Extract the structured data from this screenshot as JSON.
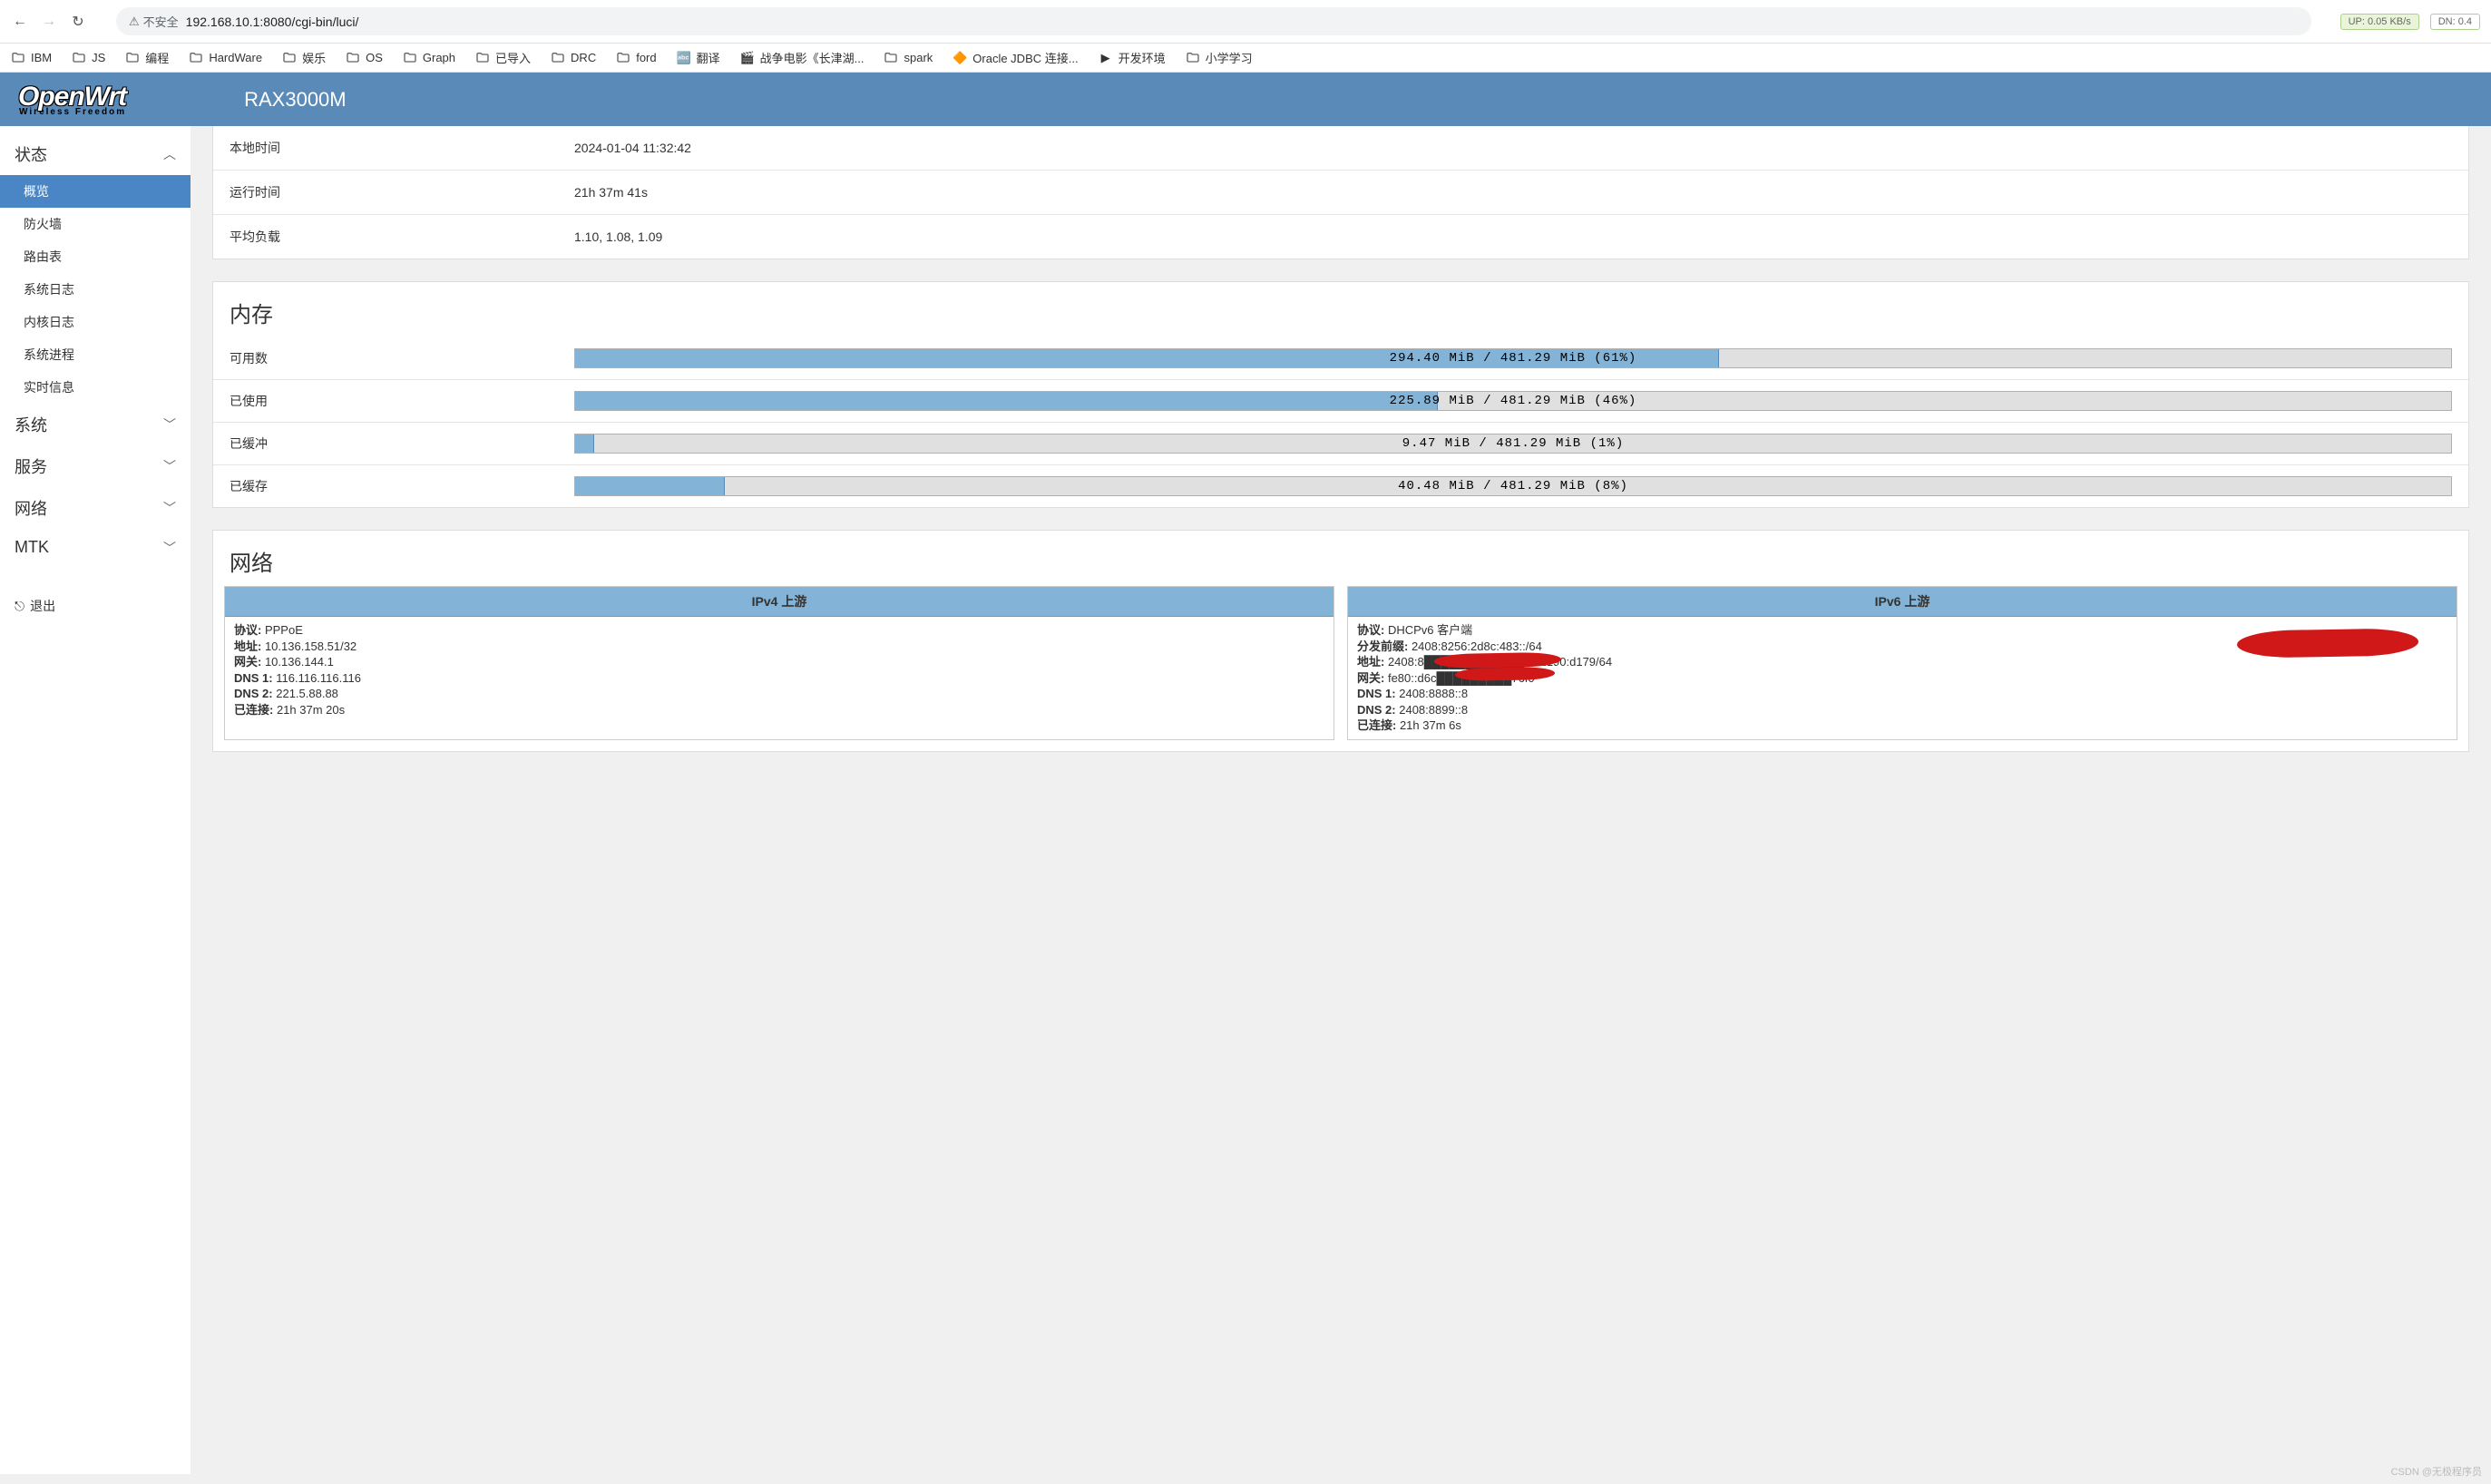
{
  "browser": {
    "security_label": "不安全",
    "url": "192.168.10.1:8080/cgi-bin/luci/",
    "up_label": "UP: 0.05 KB/s",
    "dn_label": "DN: 0.4"
  },
  "bookmarks": [
    {
      "label": "IBM",
      "type": "folder"
    },
    {
      "label": "JS",
      "type": "folder"
    },
    {
      "label": "编程",
      "type": "folder"
    },
    {
      "label": "HardWare",
      "type": "folder"
    },
    {
      "label": "娱乐",
      "type": "folder"
    },
    {
      "label": "OS",
      "type": "folder"
    },
    {
      "label": "Graph",
      "type": "folder"
    },
    {
      "label": "已导入",
      "type": "folder"
    },
    {
      "label": "DRC",
      "type": "folder"
    },
    {
      "label": "ford",
      "type": "folder"
    },
    {
      "label": "翻译",
      "type": "app",
      "icon": "🔤"
    },
    {
      "label": "战争电影《长津湖...",
      "type": "app",
      "icon": "🎬"
    },
    {
      "label": "spark",
      "type": "folder"
    },
    {
      "label": "Oracle JDBC 连接...",
      "type": "app",
      "icon": "🔶"
    },
    {
      "label": "开发环境",
      "type": "app",
      "icon": "▶"
    },
    {
      "label": "小学学习",
      "type": "folder"
    }
  ],
  "header": {
    "logo_main": "OpenWrt",
    "logo_sub": "Wireless Freedom",
    "model": "RAX3000M"
  },
  "sidebar": {
    "sections": [
      {
        "label": "状态",
        "expanded": true,
        "items": [
          {
            "label": "概览",
            "active": true
          },
          {
            "label": "防火墙"
          },
          {
            "label": "路由表"
          },
          {
            "label": "系统日志"
          },
          {
            "label": "内核日志"
          },
          {
            "label": "系统进程"
          },
          {
            "label": "实时信息"
          }
        ]
      },
      {
        "label": "系统",
        "expanded": false
      },
      {
        "label": "服务",
        "expanded": false
      },
      {
        "label": "网络",
        "expanded": false
      },
      {
        "label": "MTK",
        "expanded": false
      }
    ],
    "logout": "退出"
  },
  "system_info": {
    "rows": [
      {
        "label": "本地时间",
        "value": "2024-01-04 11:32:42"
      },
      {
        "label": "运行时间",
        "value": "21h 37m 41s"
      },
      {
        "label": "平均负载",
        "value": "1.10, 1.08, 1.09"
      }
    ]
  },
  "memory": {
    "title": "内存",
    "rows": [
      {
        "label": "可用数",
        "text": "294.40 MiB / 481.29 MiB (61%)",
        "pct": 61
      },
      {
        "label": "已使用",
        "text": "225.89 MiB / 481.29 MiB (46%)",
        "pct": 46
      },
      {
        "label": "已缓冲",
        "text": "9.47 MiB / 481.29 MiB (1%)",
        "pct": 1
      },
      {
        "label": "已缓存",
        "text": "40.48 MiB / 481.29 MiB (8%)",
        "pct": 8
      }
    ]
  },
  "network": {
    "title": "网络",
    "ipv4": {
      "title": "IPv4 上游",
      "lines": [
        {
          "k": "协议:",
          "v": " PPPoE"
        },
        {
          "k": "地址:",
          "v": " 10.136.158.51/32"
        },
        {
          "k": "网关:",
          "v": " 10.136.144.1"
        },
        {
          "k": "DNS 1:",
          "v": " 116.116.116.116"
        },
        {
          "k": "DNS 2:",
          "v": " 221.5.88.88"
        },
        {
          "k": "已连接:",
          "v": " 21h 37m 20s"
        }
      ]
    },
    "ipv6": {
      "title": "IPv6 上游",
      "lines": [
        {
          "k": "协议:",
          "v": " DHCPv6 客户端"
        },
        {
          "k": "分发前缀:",
          "v": " 2408:8256:2d8c:483::/64"
        },
        {
          "k": "地址:",
          "v": " 2408:8████████████0c:2190:d179/64"
        },
        {
          "k": "网关:",
          "v": " fe80::d6c█████████76f0"
        },
        {
          "k": "DNS 1:",
          "v": " 2408:8888::8"
        },
        {
          "k": "DNS 2:",
          "v": " 2408:8899::8"
        },
        {
          "k": "已连接:",
          "v": " 21h 37m 6s"
        }
      ]
    }
  },
  "watermark": "CSDN @无极程序员"
}
